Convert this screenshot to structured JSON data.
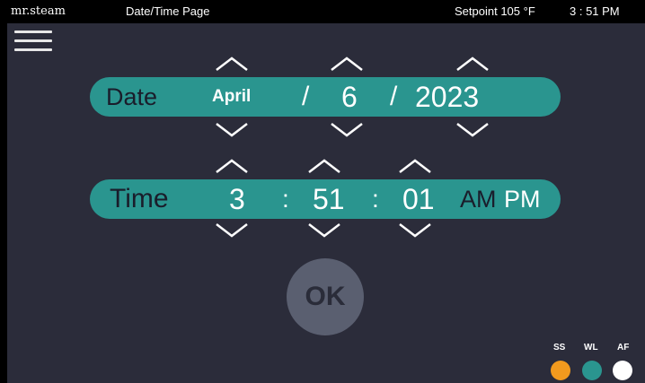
{
  "topbar": {
    "brand": "mr.steam",
    "page_title": "Date/Time Page",
    "setpoint": "Setpoint  105 °F",
    "time": "3 : 51  PM"
  },
  "date": {
    "label": "Date",
    "month": "April",
    "sep1": "/",
    "day": "6",
    "sep2": "/",
    "year": "2023"
  },
  "time": {
    "label": "Time",
    "hour": "3",
    "sep1": ":",
    "minute": "51",
    "sep2": ":",
    "second": "01",
    "am": "AM",
    "pm": "PM"
  },
  "ok_label": "OK",
  "indicators": [
    {
      "label": "SS",
      "color": "#f29a1e"
    },
    {
      "label": "WL",
      "color": "#2a958f"
    },
    {
      "label": "AF",
      "color": "#ffffff"
    }
  ],
  "colors": {
    "background": "#2b2c3a",
    "accent": "#2a958f",
    "ok_button": "#5a5f70"
  },
  "icons": {
    "menu": "hamburger-menu-icon",
    "up": "chevron-up-icon",
    "down": "chevron-down-icon"
  }
}
